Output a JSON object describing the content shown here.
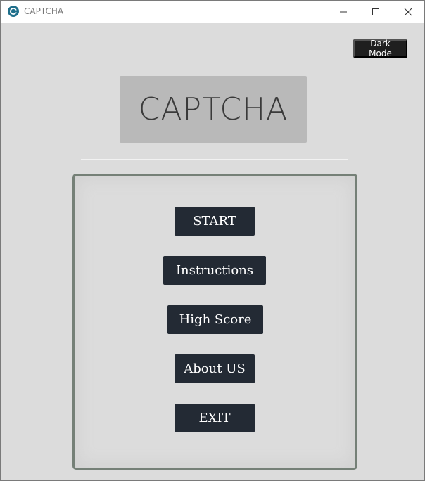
{
  "window": {
    "title": "CAPTCHA"
  },
  "dark_mode_label": "Dark Mode",
  "logo_text": "CAPTCHA",
  "menu": {
    "start": "START",
    "instructions": "Instructions",
    "high_score": "High Score",
    "about": "About US",
    "exit": "EXIT"
  },
  "colors": {
    "button_bg": "#232a34",
    "panel_border": "#758077",
    "logo_bg": "#b9b9b9",
    "background": "#dcdcdc"
  }
}
